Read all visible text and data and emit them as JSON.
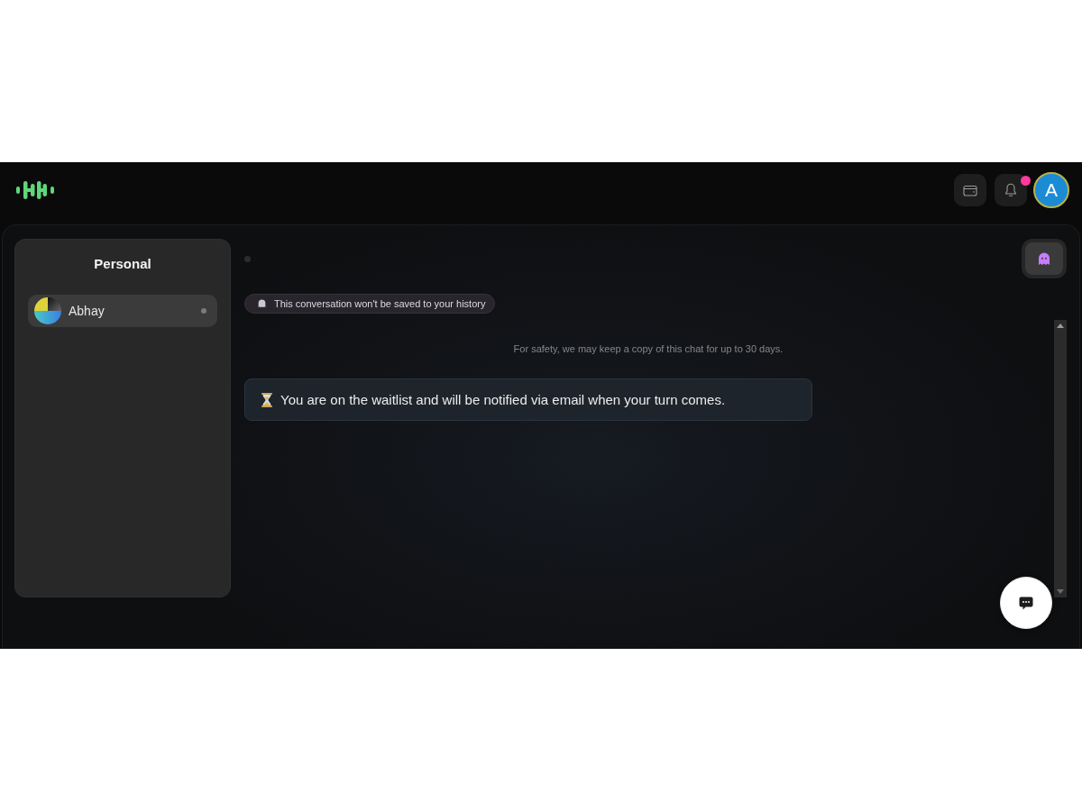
{
  "header": {
    "notifications": {
      "unread": true
    },
    "account": {
      "initial": "A"
    }
  },
  "sidebar": {
    "title": "Personal",
    "chats": [
      {
        "name": "Abhay",
        "selected": true
      }
    ]
  },
  "chat": {
    "private_mode": {
      "on": true
    },
    "notice": "This conversation won't be saved to your history",
    "safety_note": "For safety, we may keep a copy of this chat for up to 30 days.",
    "messages": [
      {
        "text": "You are on the waitlist and will be notified via email when your turn comes."
      }
    ]
  }
}
